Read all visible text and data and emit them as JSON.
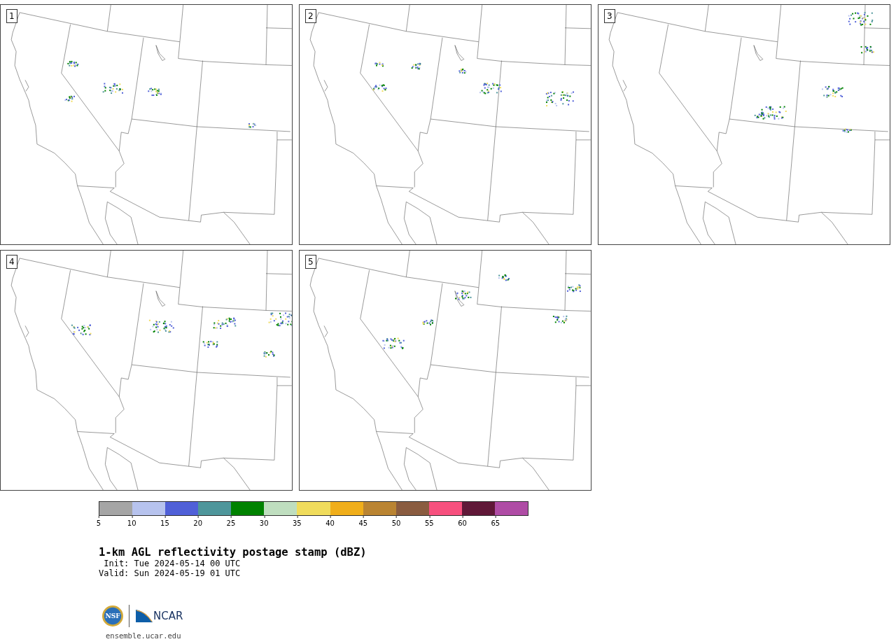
{
  "panels": [
    {
      "label": "1"
    },
    {
      "label": "2"
    },
    {
      "label": "3"
    },
    {
      "label": "4"
    },
    {
      "label": "5"
    }
  ],
  "colorbar": {
    "bins": [
      {
        "color": "#a5a5a5"
      },
      {
        "color": "#b7c3ee"
      },
      {
        "color": "#5060d8"
      },
      {
        "color": "#4e969b"
      },
      {
        "color": "#008200"
      },
      {
        "color": "#bfdebf"
      },
      {
        "color": "#f0dc5c"
      },
      {
        "color": "#f0ae1a"
      },
      {
        "color": "#ba8432"
      },
      {
        "color": "#8a5c40"
      },
      {
        "color": "#f7507e"
      },
      {
        "color": "#601838"
      },
      {
        "color": "#af4ca5"
      }
    ],
    "ticks": [
      "5",
      "10",
      "15",
      "20",
      "25",
      "30",
      "35",
      "40",
      "45",
      "50",
      "55",
      "60",
      "65"
    ]
  },
  "title": "1-km AGL reflectivity postage stamp (dBZ)",
  "init": " Init: Tue 2024-05-14 00 UTC",
  "valid": "Valid: Sun 2024-05-19 01 UTC",
  "logo": {
    "nsf": "NSF",
    "ncar": "NCAR"
  },
  "url": "ensemble.ucar.edu"
}
